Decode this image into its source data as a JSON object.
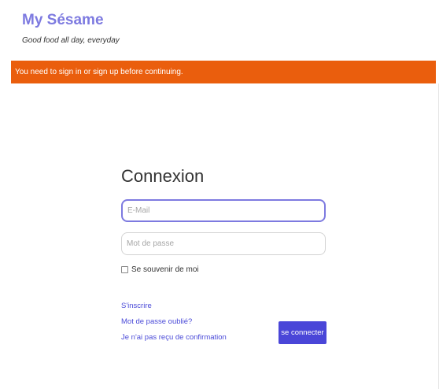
{
  "brand": {
    "title": "My Sésame",
    "tagline": "Good food all day, everyday"
  },
  "alert": {
    "message": "You need to sign in or sign up before continuing."
  },
  "login": {
    "title": "Connexion",
    "email": {
      "value": "",
      "placeholder": "E-Mail"
    },
    "password": {
      "value": "",
      "placeholder": "Mot de passe"
    },
    "remember_me": {
      "label": "Se souvenir de moi",
      "checked": false
    },
    "links": {
      "signup": "S'inscrire",
      "forgot_password": "Mot de passe oublié?",
      "resend_confirmation": "Je n'ai pas reçu de confirmation"
    },
    "submit_label": "se connecter"
  },
  "colors": {
    "brand": "#7d7ae0",
    "alert_background": "#ea5e0d",
    "button_background": "#4a46d8",
    "link": "#4a4ad8"
  }
}
